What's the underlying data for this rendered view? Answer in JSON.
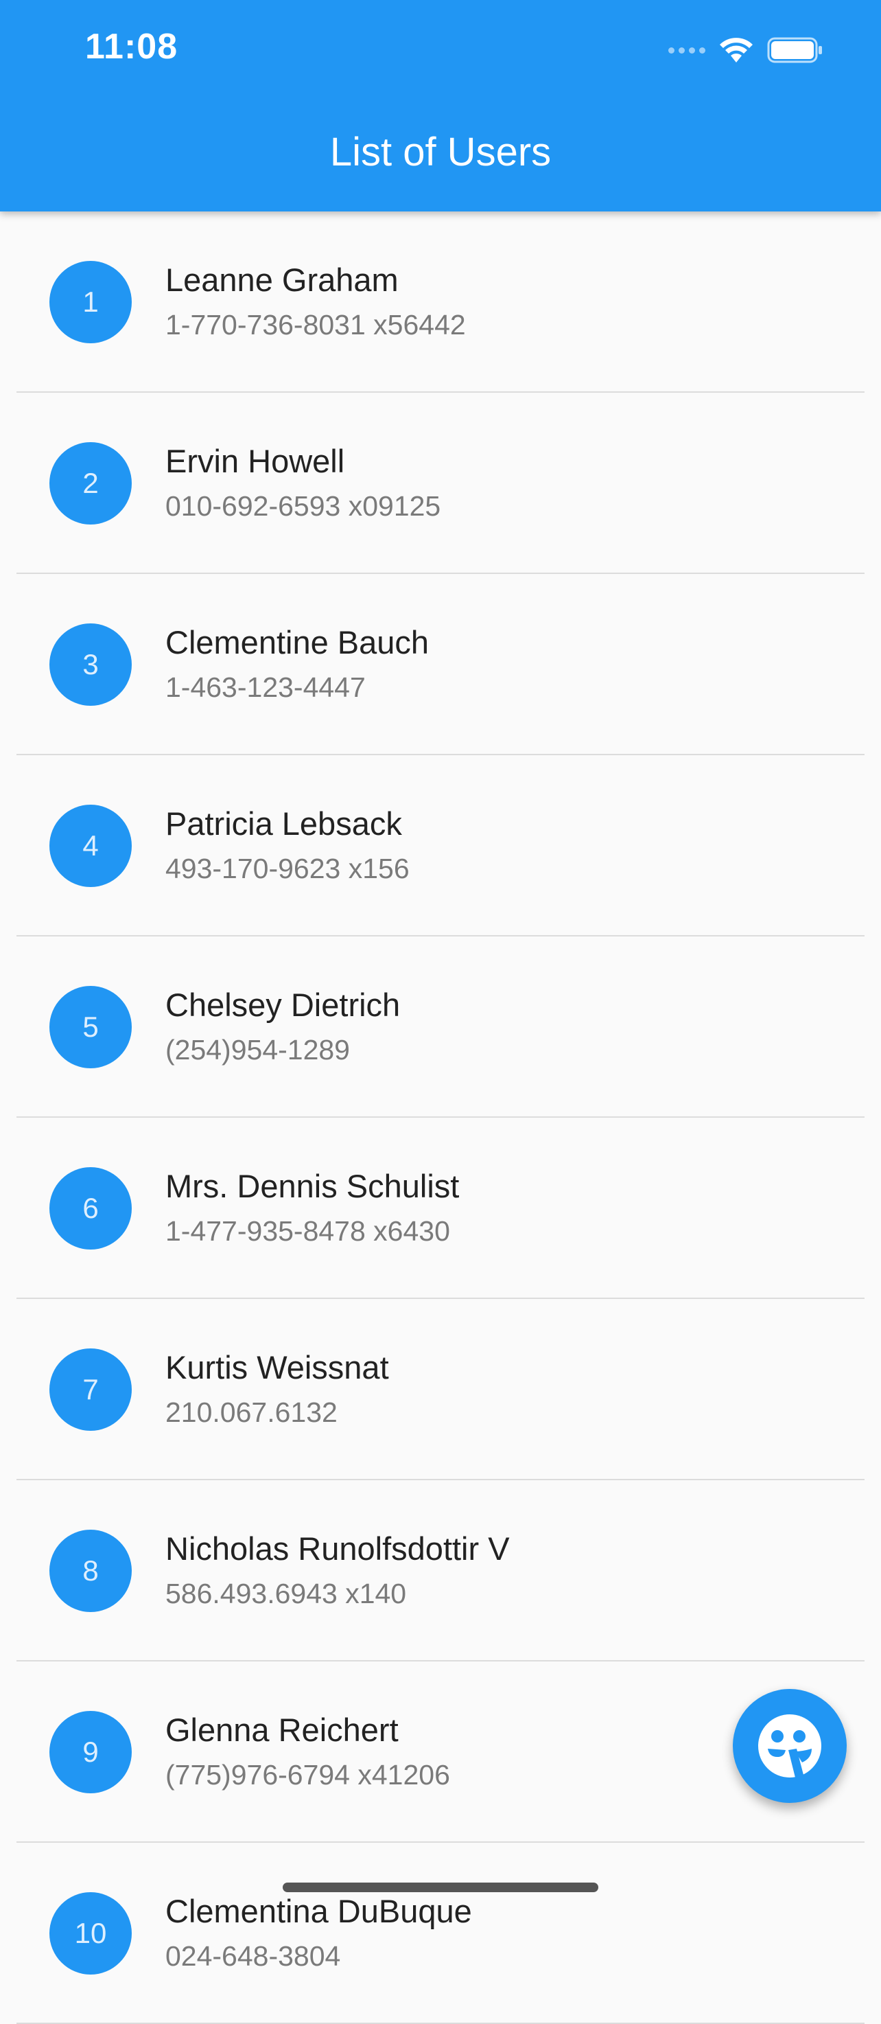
{
  "status_bar": {
    "time": "11:08"
  },
  "appbar": {
    "title": "List of Users",
    "color": "#2196f3"
  },
  "users": [
    {
      "index": "1",
      "name": "Leanne Graham",
      "phone": "1-770-736-8031 x56442"
    },
    {
      "index": "2",
      "name": "Ervin Howell",
      "phone": "010-692-6593 x09125"
    },
    {
      "index": "3",
      "name": "Clementine Bauch",
      "phone": "1-463-123-4447"
    },
    {
      "index": "4",
      "name": "Patricia Lebsack",
      "phone": "493-170-9623 x156"
    },
    {
      "index": "5",
      "name": "Chelsey Dietrich",
      "phone": "(254)954-1289"
    },
    {
      "index": "6",
      "name": "Mrs. Dennis Schulist",
      "phone": "1-477-935-8478 x6430"
    },
    {
      "index": "7",
      "name": "Kurtis Weissnat",
      "phone": "210.067.6132"
    },
    {
      "index": "8",
      "name": "Nicholas Runolfsdottir V",
      "phone": "586.493.6943 x140"
    },
    {
      "index": "9",
      "name": "Glenna Reichert",
      "phone": "(775)976-6794 x41206"
    },
    {
      "index": "10",
      "name": "Clementina DuBuque",
      "phone": "024-648-3804"
    }
  ],
  "fab": {
    "icon": "face-icon"
  }
}
